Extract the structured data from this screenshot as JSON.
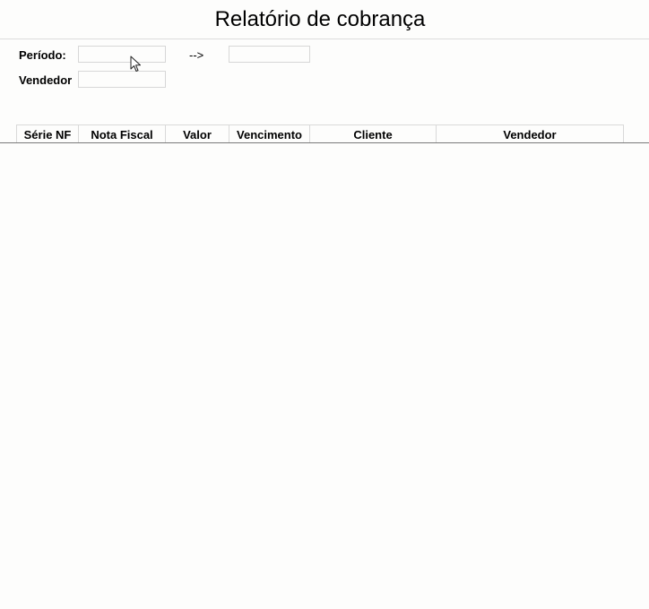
{
  "report": {
    "title": "Relatório de cobrança"
  },
  "filters": {
    "period_label": "Período:",
    "period_start": "",
    "period_arrow": "-->",
    "period_end": "",
    "seller_label": "Vendedor",
    "seller_value": ""
  },
  "table": {
    "columns": [
      "Série NF",
      "Nota Fiscal",
      "Valor",
      "Vencimento",
      "Cliente",
      "Vendedor"
    ],
    "rows": []
  }
}
